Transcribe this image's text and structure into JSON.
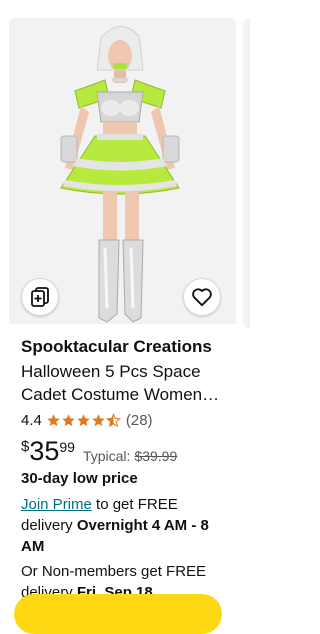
{
  "product": {
    "brand": "Spooktacular Creations",
    "title": "Halloween 5 Pcs Space Cadet Costume Women…",
    "rating": "4.4",
    "stars": 4.4,
    "review_count": "(28)",
    "price": {
      "symbol": "$",
      "whole": "35",
      "fraction": "99",
      "typical_label": "Typical:",
      "typical_price": "$39.99"
    },
    "low_price_label": "30-day low price"
  },
  "delivery": {
    "join_prime": "Join Prime",
    "prime_text": " to get FREE delivery ",
    "prime_date": "Overnight 4 AM - 8 AM",
    "nonmember_text": "Or Non-members get FREE delivery ",
    "nonmember_date": "Fri, Sep 18"
  },
  "icons": {
    "compare": "compare-cards-icon",
    "wishlist": "heart-icon",
    "rating": "star-icon"
  },
  "colors": {
    "link": "#007185",
    "star": "#de7921",
    "button": "#ffd814",
    "costume_green": "#b7ea3f"
  }
}
